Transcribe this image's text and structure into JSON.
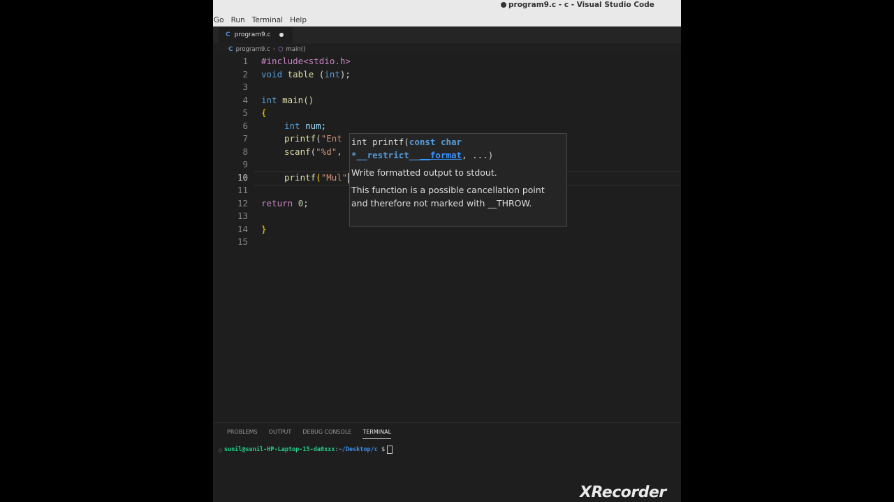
{
  "window": {
    "title": "program9.c - c - Visual Studio Code",
    "menu": [
      "Go",
      "Run",
      "Terminal",
      "Help"
    ]
  },
  "tab": {
    "icon": "C",
    "label": "program9.c",
    "modified": true
  },
  "breadcrumb": {
    "file": "program9.c",
    "symbol": "main()"
  },
  "editor": {
    "line_numbers": [
      "1",
      "2",
      "3",
      "4",
      "5",
      "6",
      "7",
      "8",
      "9",
      "10",
      "11",
      "12",
      "13",
      "14",
      "15"
    ],
    "active_line": "10",
    "lines": {
      "l1": "#include<stdio.h>",
      "l2a": "void",
      "l2b": " table (",
      "l2c": "int",
      "l2d": ");",
      "l4a": "int",
      "l4b": " main()",
      "l5": "{",
      "l6a": "int",
      "l6b": " num;",
      "l7a": "printf",
      "l7b": "(",
      "l7c": "\"Ent",
      "l8a": "scanf",
      "l8b": "(",
      "l8c": "\"%d\"",
      "l8d": ",",
      "l10a": "printf",
      "l10b": "(",
      "l10c": "\"Mul",
      "l10d": "\"",
      "l10e": ")",
      "l12a": "return",
      "l12b": " ",
      "l12c": "0",
      "l12d": ";",
      "l14": "}"
    }
  },
  "hover": {
    "sig_pre": "int printf(",
    "sig_param": "const char *__restrict__",
    "sig_active": "__format",
    "sig_post": ", ...)",
    "desc1": "Write formatted output to stdout.",
    "desc2": "This function is a possible cancellation point and therefore not marked with __THROW."
  },
  "panel": {
    "tabs": [
      "PROBLEMS",
      "OUTPUT",
      "DEBUG CONSOLE",
      "TERMINAL"
    ],
    "active_tab": "TERMINAL",
    "terminal": {
      "user": "sunil@sunil-HP-Laptop-15-da0xxx",
      "colon": ":",
      "path": "~/Desktop/c",
      "prompt": " $ "
    }
  },
  "watermark": "XRecorder"
}
